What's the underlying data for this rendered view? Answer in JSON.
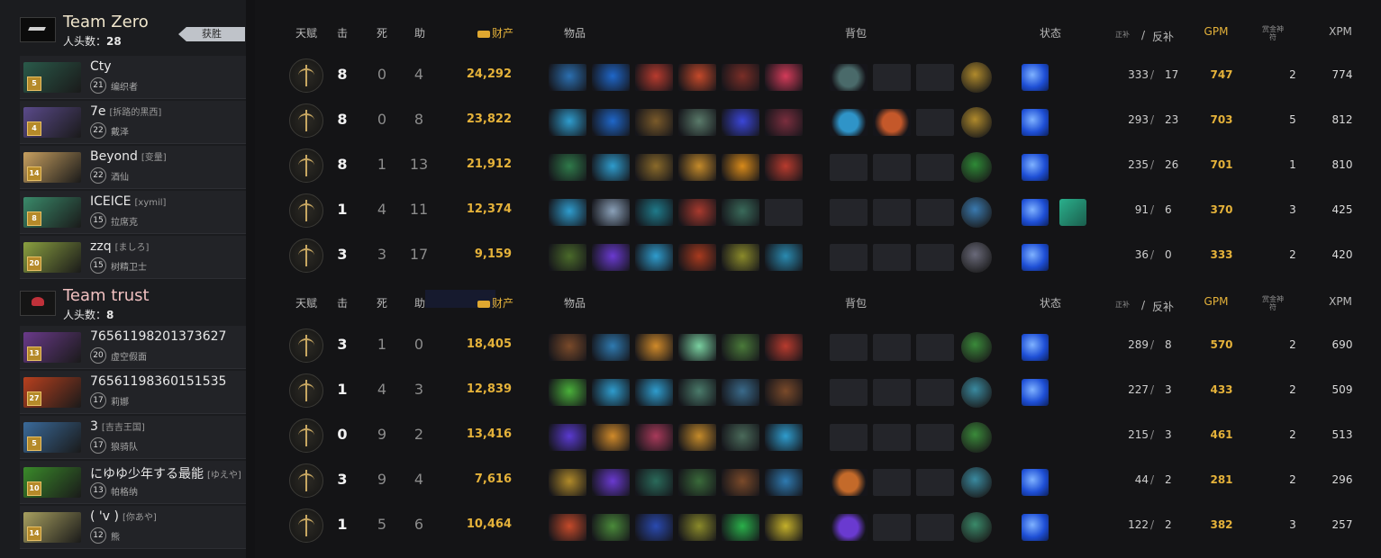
{
  "teams": [
    {
      "name": "Team Zero",
      "kills_label": "人头数：",
      "kills": "28",
      "winner_label": "获胜",
      "players": [
        {
          "name": "Cty",
          "alias": "",
          "level": "21",
          "hero": "编织者",
          "lvl_badge": "5"
        },
        {
          "name": "7e",
          "alias": "[拆路的黑西]",
          "level": "22",
          "hero": "戴泽",
          "lvl_badge": "4"
        },
        {
          "name": "Beyond",
          "alias": "[变量]",
          "level": "22",
          "hero": "酒仙",
          "lvl_badge": "14"
        },
        {
          "name": "ICEICE",
          "alias": "[xymil]",
          "level": "15",
          "hero": "拉席克",
          "lvl_badge": "8"
        },
        {
          "name": "zzq",
          "alias": "[ましろ]",
          "level": "15",
          "hero": "树精卫士",
          "lvl_badge": "20"
        }
      ]
    },
    {
      "name": "Team trust",
      "kills_label": "人头数：",
      "kills": "8",
      "winner_label": "",
      "players": [
        {
          "name": "76561198201373627",
          "alias": "",
          "level": "20",
          "hero": "虚空假面",
          "lvl_badge": "13"
        },
        {
          "name": "76561198360151535",
          "alias": "",
          "level": "17",
          "hero": "莉娜",
          "lvl_badge": "27"
        },
        {
          "name": "3",
          "alias": "[吉吉王国]",
          "level": "17",
          "hero": "狼骑队",
          "lvl_badge": "5"
        },
        {
          "name": "にゆゆ少年する最能",
          "alias": "[ゆえや]",
          "level": "13",
          "hero": "帕格纳",
          "lvl_badge": "10"
        },
        {
          "name": "( 'v )",
          "alias": "[你あや]",
          "level": "12",
          "hero": "熊",
          "lvl_badge": "14"
        }
      ]
    }
  ],
  "headers": {
    "talent": "天赋",
    "kills": "击",
    "deaths": "死",
    "assists": "助",
    "networth": "财产",
    "items": "物品",
    "backpack": "背包",
    "status": "状态",
    "lh_small": "正补",
    "slash": "/",
    "denies": "反补",
    "gpm": "GPM",
    "bounty": "赏金神符",
    "xpm": "XPM"
  },
  "stats": [
    [
      {
        "k": "8",
        "d": "0",
        "a": "4",
        "nw": "24,292",
        "lh": "333",
        "dn": "17",
        "gpm": "747",
        "bounty": "2",
        "xpm": "774",
        "items": [
          "#2b6fb0",
          "#1f67c9",
          "#b83b2e",
          "#c4492a",
          "#7a2e27",
          "#d33b59"
        ],
        "bp": [
          "#4a6a6a",
          "",
          "",
          ""
        ],
        "neutral": "#b08a2c",
        "buff": true,
        "buff2": false
      },
      {
        "k": "8",
        "d": "0",
        "a": "8",
        "nw": "23,822",
        "lh": "293",
        "dn": "23",
        "gpm": "703",
        "bounty": "5",
        "xpm": "812",
        "items": [
          "#2f9ccd",
          "#1f67c9",
          "#7a5a2a",
          "#5a7a6a",
          "#3b46d8",
          "#7a2e3e"
        ],
        "bp": [
          "#2f94c8",
          "#c4582a",
          ""
        ],
        "neutral": "#b08a2c",
        "buff": true,
        "buff2": false
      },
      {
        "k": "8",
        "d": "1",
        "a": "13",
        "nw": "21,912",
        "lh": "235",
        "dn": "26",
        "gpm": "701",
        "bounty": "1",
        "xpm": "810",
        "items": [
          "#2f7a4a",
          "#2f9ccd",
          "#8a6a2a",
          "#c48a2a",
          "#d88a1a",
          "#b83b2e"
        ],
        "bp": [
          "",
          "",
          ""
        ],
        "neutral": "#2e8a36",
        "buff": true,
        "buff2": false
      },
      {
        "k": "1",
        "d": "4",
        "a": "11",
        "nw": "12,374",
        "lh": "91",
        "dn": "6",
        "gpm": "370",
        "bounty": "3",
        "xpm": "425",
        "items": [
          "#2f9ccd",
          "#8aa0b8",
          "#1f7a8a",
          "#a83a2e",
          "#3a6a5a",
          ""
        ],
        "bp": [
          "",
          "",
          ""
        ],
        "neutral": "#3a7ab0",
        "buff": true,
        "buff2": true
      },
      {
        "k": "3",
        "d": "3",
        "a": "17",
        "nw": "9,159",
        "lh": "36",
        "dn": "0",
        "gpm": "333",
        "bounty": "2",
        "xpm": "420",
        "items": [
          "#4a6a2a",
          "#6a3ad0",
          "#2f9ccd",
          "#a83a1e",
          "#8a8a2a",
          "#2a8ab0"
        ],
        "bp": [
          "",
          "",
          ""
        ],
        "neutral": "#6a6a7a",
        "buff": true,
        "buff2": false
      }
    ],
    [
      {
        "k": "3",
        "d": "1",
        "a": "0",
        "nw": "18,405",
        "lh": "289",
        "dn": "8",
        "gpm": "570",
        "bounty": "2",
        "xpm": "690",
        "items": [
          "#7a4a2a",
          "#2f7ab0",
          "#d08a2a",
          "#7ad0a0",
          "#4a7a3a",
          "#b83b2e"
        ],
        "bp": [
          "",
          "",
          ""
        ],
        "neutral": "#3a8a3a",
        "buff": true,
        "buff2": false
      },
      {
        "k": "1",
        "d": "4",
        "a": "3",
        "nw": "12,839",
        "lh": "227",
        "dn": "3",
        "gpm": "433",
        "bounty": "2",
        "xpm": "509",
        "items": [
          "#4ab03a",
          "#2f9ccd",
          "#2f9ccd",
          "#4a7a6a",
          "#3a6a8a",
          "#7a4a2a"
        ],
        "bp": [
          "",
          "",
          ""
        ],
        "neutral": "#3a8aa0",
        "buff": true,
        "buff2": false
      },
      {
        "k": "0",
        "d": "9",
        "a": "2",
        "nw": "13,416",
        "lh": "215",
        "dn": "3",
        "gpm": "461",
        "bounty": "2",
        "xpm": "513",
        "items": [
          "#5a3ad0",
          "#d08a2a",
          "#a83a5a",
          "#c48a2a",
          "#4a6a5a",
          "#2f9ccd"
        ],
        "bp": [
          "",
          "",
          ""
        ],
        "neutral": "#3a8a3a",
        "buff": false,
        "buff2": false
      },
      {
        "k": "3",
        "d": "9",
        "a": "4",
        "nw": "7,616",
        "lh": "44",
        "dn": "2",
        "gpm": "281",
        "bounty": "2",
        "xpm": "296",
        "items": [
          "#b08a2a",
          "#6a3ad0",
          "#2a6a5a",
          "#3a6a3a",
          "#7a4a2a",
          "#2f7ab0"
        ],
        "bp": [
          "#c46a2a",
          "",
          ""
        ],
        "neutral": "#3a8aa0",
        "buff": true,
        "buff2": false
      },
      {
        "k": "1",
        "d": "5",
        "a": "6",
        "nw": "10,464",
        "lh": "122",
        "dn": "2",
        "gpm": "382",
        "bounty": "3",
        "xpm": "257",
        "items": [
          "#c44a2a",
          "#4a8a3a",
          "#2a4ab0",
          "#8a8a2a",
          "#2ab04a",
          "#c4b02a"
        ],
        "bp": [
          "#6a3ad0",
          "",
          ""
        ],
        "neutral": "#3a8a6a",
        "buff": true,
        "buff2": false
      }
    ]
  ],
  "portraits": [
    [
      "#2a5a4a",
      "#5a4a8a",
      "#c8a060",
      "#3a8a6a",
      "#8aa040"
    ],
    [
      "#6a3a8a",
      "#b8401e",
      "#3a6a9a",
      "#3a8a2a",
      "#a8a060"
    ]
  ]
}
